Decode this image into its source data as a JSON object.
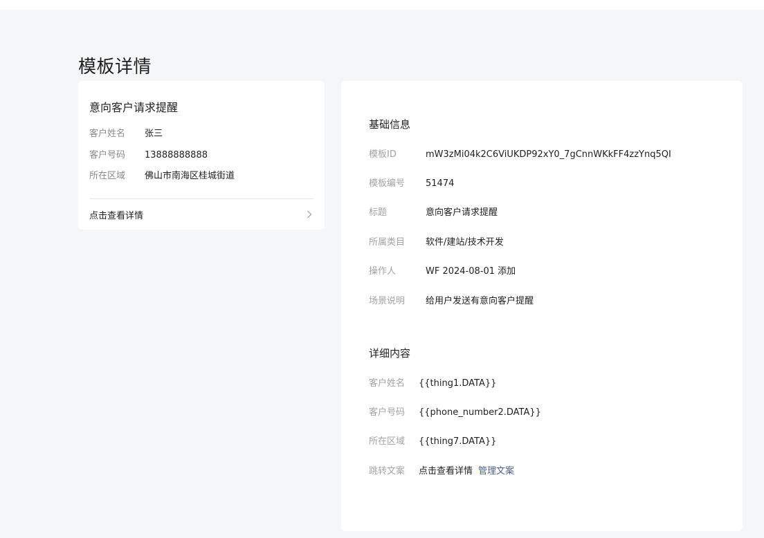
{
  "page": {
    "title": "模板详情"
  },
  "preview": {
    "title": "意向客户请求提醒",
    "rows": [
      {
        "label": "客户姓名",
        "value": "张三"
      },
      {
        "label": "客户号码",
        "value": "13888888888"
      },
      {
        "label": "所在区域",
        "value": "佛山市南海区桂城街道"
      }
    ],
    "link_label": "点击查看详情",
    "link_icon": "chevron-right-icon"
  },
  "basic": {
    "title": "基础信息",
    "rows": [
      {
        "label": "模板ID",
        "value": "mW3zMi04k2C6ViUKDP92xY0_7gCnnWKkFF4zzYnq5QI"
      },
      {
        "label": "模板编号",
        "value": "51474"
      },
      {
        "label": "标题",
        "value": "意向客户请求提醒"
      },
      {
        "label": "所属类目",
        "value": "软件/建站/技术开发"
      },
      {
        "label": "操作人",
        "value": "WF 2024-08-01 添加"
      },
      {
        "label": "场景说明",
        "value": "给用户发送有意向客户提醒"
      }
    ]
  },
  "detail": {
    "title": "详细内容",
    "rows": [
      {
        "label": "客户姓名",
        "value": "{{thing1.DATA}}"
      },
      {
        "label": "客户号码",
        "value": "{{phone_number2.DATA}}"
      },
      {
        "label": "所在区域",
        "value": "{{thing7.DATA}}"
      },
      {
        "label": "跳转文案",
        "value": "点击查看详情",
        "link": "管理文案"
      }
    ]
  },
  "colors": {
    "background": "#f5f6f7",
    "card": "#ffffff",
    "label": "#a3a3a3",
    "link": "#4a5f87"
  }
}
